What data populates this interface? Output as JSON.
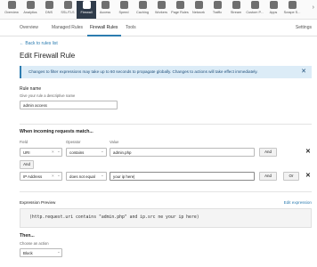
{
  "nav": {
    "items": [
      {
        "label": "Overview",
        "icon": "overview-icon"
      },
      {
        "label": "Analytics",
        "icon": "analytics-icon"
      },
      {
        "label": "DNS",
        "icon": "dns-icon"
      },
      {
        "label": "SSL/TLS",
        "icon": "lock-icon"
      },
      {
        "label": "Firewall",
        "icon": "firewall-icon",
        "active": true
      },
      {
        "label": "Access",
        "icon": "access-icon"
      },
      {
        "label": "Speed",
        "icon": "speed-icon"
      },
      {
        "label": "Caching",
        "icon": "caching-icon"
      },
      {
        "label": "Workers",
        "icon": "workers-icon"
      },
      {
        "label": "Page Rules",
        "icon": "page-rules-icon"
      },
      {
        "label": "Network",
        "icon": "network-icon"
      },
      {
        "label": "Traffic",
        "icon": "traffic-icon"
      },
      {
        "label": "Stream",
        "icon": "stream-icon"
      },
      {
        "label": "Custom P...",
        "icon": "custom-pages-icon"
      },
      {
        "label": "Apps",
        "icon": "apps-icon"
      },
      {
        "label": "Scrape S...",
        "icon": "scrape-shield-icon"
      }
    ]
  },
  "tabs": [
    {
      "label": "Overview"
    },
    {
      "label": "Managed Rules"
    },
    {
      "label": "Firewall Rules",
      "active": true
    },
    {
      "label": "Tools"
    }
  ],
  "settings_label": "Settings",
  "back_link": "← Back to rules list",
  "page_title": "Edit Firewall Rule",
  "notice": {
    "text": "Changes to filter expressions may take up to 60 seconds to propagate globally. Changes to actions will take effect immediately.",
    "close": "✕"
  },
  "rule_name": {
    "label": "Rule name",
    "hint": "Give your rule a descriptive name",
    "value": "admin access"
  },
  "match": {
    "heading": "When incoming requests match...",
    "field_header": "Field",
    "operator_header": "Operator",
    "value_header": "Value",
    "rows": [
      {
        "field": "URI",
        "operator": "contains",
        "value": "admin.php",
        "and_label": "And",
        "or_label": ""
      },
      {
        "field": "IP Address",
        "operator": "does not equal",
        "value": "your ip here|",
        "and_label": "And",
        "or_label": "Or"
      }
    ],
    "and_between": "And",
    "clear_symbol": "×",
    "chevron_symbol": "⌄",
    "delete_symbol": "✕"
  },
  "expression": {
    "label": "Expression Preview",
    "edit_link": "Edit expression",
    "text": "(http.request.uri contains \"admin.php\" and ip.src ne your ip here)"
  },
  "then": {
    "heading": "Then...",
    "hint": "Choose an action",
    "value": "Block"
  },
  "colors": {
    "accent": "#2c7cb0",
    "notice_bg": "#dcecf7",
    "active_nav_bg": "#2f3b4a"
  }
}
